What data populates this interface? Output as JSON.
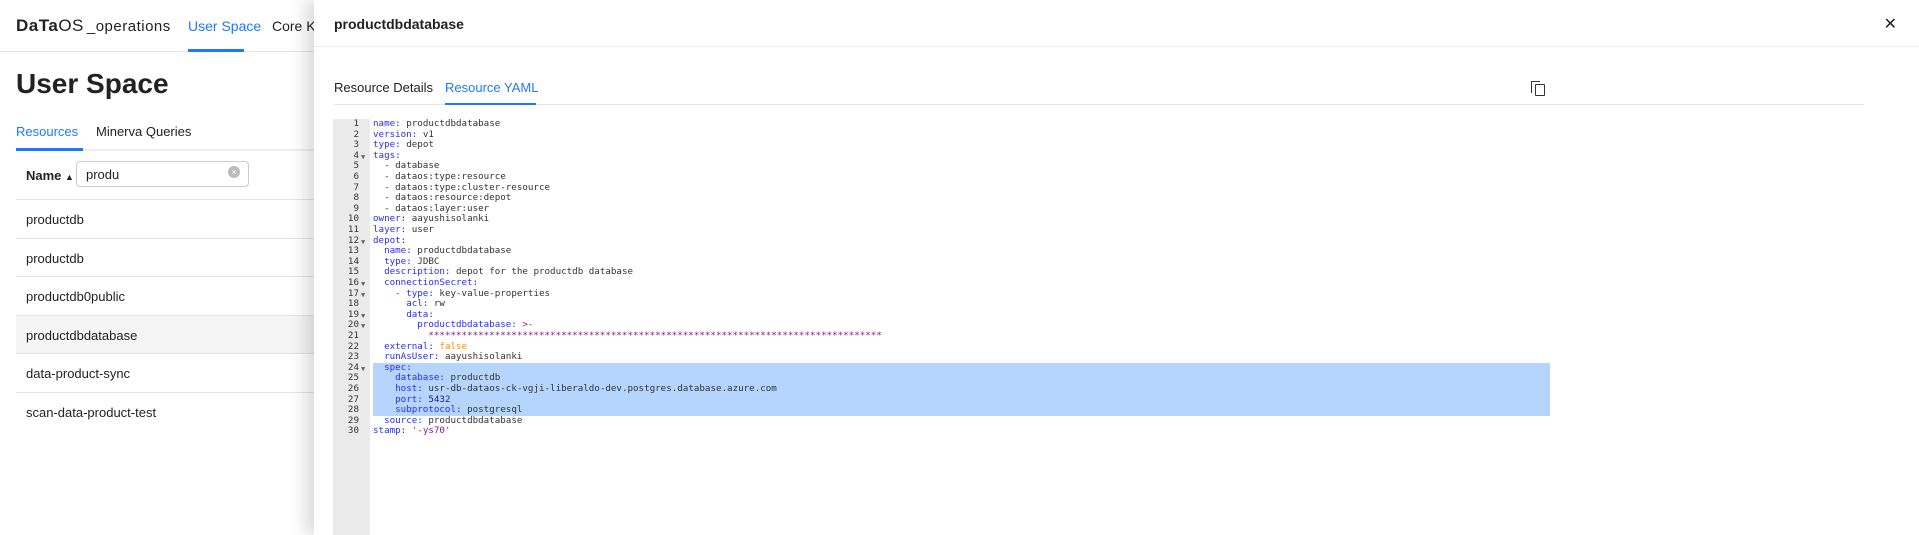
{
  "header": {
    "logo_bold": "DaTa",
    "logo_light": "OS",
    "logo_sub": "_operations",
    "nav": [
      "User Space",
      "Core Kernel"
    ]
  },
  "page": {
    "title": "User Space",
    "tabs": [
      "Resources",
      "Minerva Queries"
    ],
    "name_header": "Name",
    "sort_icon": "sort-asc-icon",
    "search_value": "produ"
  },
  "rows": [
    "productdb",
    "productdb",
    "productdb0public",
    "productdbdatabase",
    "data-product-sync",
    "scan-data-product-test"
  ],
  "panel": {
    "title": "productdbdatabase",
    "tabs": [
      "Resource Details",
      "Resource YAML"
    ],
    "active_tab": "Resource YAML",
    "close": "✕"
  },
  "colors": {
    "accent": "#1e78ff",
    "highlight": "#b5d5ff"
  },
  "yaml": [
    {
      "k": "name:",
      "v": "productdbdatabase",
      "i": 0
    },
    {
      "k": "version:",
      "v": "v1",
      "i": 0
    },
    {
      "k": "type:",
      "v": "depot",
      "i": 0
    },
    {
      "k": "tags:",
      "v": "",
      "i": 0,
      "fold": true
    },
    {
      "k": "",
      "v": "- database",
      "i": 2
    },
    {
      "k": "",
      "v": "- dataos:type:resource",
      "i": 2
    },
    {
      "k": "",
      "v": "- dataos:type:cluster-resource",
      "i": 2
    },
    {
      "k": "",
      "v": "- dataos:resource:depot",
      "i": 2
    },
    {
      "k": "",
      "v": "- dataos:layer:user",
      "i": 2
    },
    {
      "k": "owner:",
      "v": "aayushisolanki",
      "i": 0
    },
    {
      "k": "layer:",
      "v": "user",
      "i": 0
    },
    {
      "k": "depot:",
      "v": "",
      "i": 0,
      "fold": true
    },
    {
      "k": "name:",
      "v": "productdbdatabase",
      "i": 2
    },
    {
      "k": "type:",
      "v": "JDBC",
      "i": 2
    },
    {
      "k": "description:",
      "v": "depot for the productdb database",
      "i": 2
    },
    {
      "k": "connectionSecret:",
      "v": "",
      "i": 2,
      "fold": true
    },
    {
      "k": "- type:",
      "v": "key-value-properties",
      "i": 4,
      "fold": true
    },
    {
      "k": "acl:",
      "v": "rw",
      "i": 6
    },
    {
      "k": "data:",
      "v": "",
      "i": 6,
      "fold": true
    },
    {
      "k": "productdbdatabase:",
      "v": ">-",
      "i": 8,
      "fold": true,
      "cls": "s"
    },
    {
      "k": "",
      "v": "**********************************************************************************",
      "i": 10,
      "cls": "s"
    },
    {
      "k": "external:",
      "v": "false",
      "i": 2,
      "cls": "b"
    },
    {
      "k": "runAsUser:",
      "v": "aayushisolanki",
      "i": 2
    },
    {
      "k": "spec:",
      "v": "",
      "i": 2,
      "fold": true,
      "hl": true
    },
    {
      "k": "database:",
      "v": "productdb",
      "i": 4,
      "hl": true
    },
    {
      "k": "host:",
      "v": "usr-db-dataos-ck-vgji-liberaldo-dev.postgres.database.azure.com",
      "i": 4,
      "hl": true
    },
    {
      "k": "port:",
      "v": "5432",
      "i": 4,
      "hl": true,
      "cls": "n"
    },
    {
      "k": "subprotocol:",
      "v": "postgresql",
      "i": 4,
      "hl": true
    },
    {
      "k": "source:",
      "v": "productdbdatabase",
      "i": 2
    },
    {
      "k": "stamp:",
      "v": "'-ys70'",
      "i": 0,
      "cls": "s"
    }
  ]
}
